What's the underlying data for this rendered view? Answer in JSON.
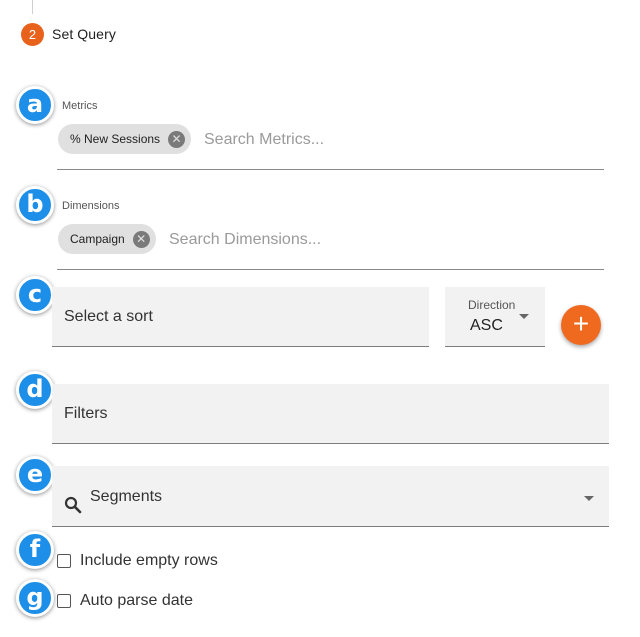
{
  "step": {
    "number": "2",
    "title": "Set Query"
  },
  "markers": [
    "a",
    "b",
    "c",
    "d",
    "e",
    "f",
    "g"
  ],
  "metrics": {
    "label": "Metrics",
    "chips": [
      "% New Sessions"
    ],
    "placeholder": "Search Metrics..."
  },
  "dimensions": {
    "label": "Dimensions",
    "chips": [
      "Campaign"
    ],
    "placeholder": "Search Dimensions..."
  },
  "sort": {
    "placeholder": "Select a sort",
    "direction_label": "Direction",
    "direction_value": "ASC",
    "add_icon": "plus-icon",
    "add_symbol": "+"
  },
  "filters": {
    "label": "Filters"
  },
  "segments": {
    "label": "Segments",
    "icon": "search-icon"
  },
  "options": {
    "include_empty_rows": {
      "label": "Include empty rows",
      "checked": false
    },
    "auto_parse_date": {
      "label": "Auto parse date",
      "checked": false
    }
  },
  "colors": {
    "accent": "#e8621c",
    "marker": "#1d8fe8",
    "fab": "#ef6a1f"
  }
}
